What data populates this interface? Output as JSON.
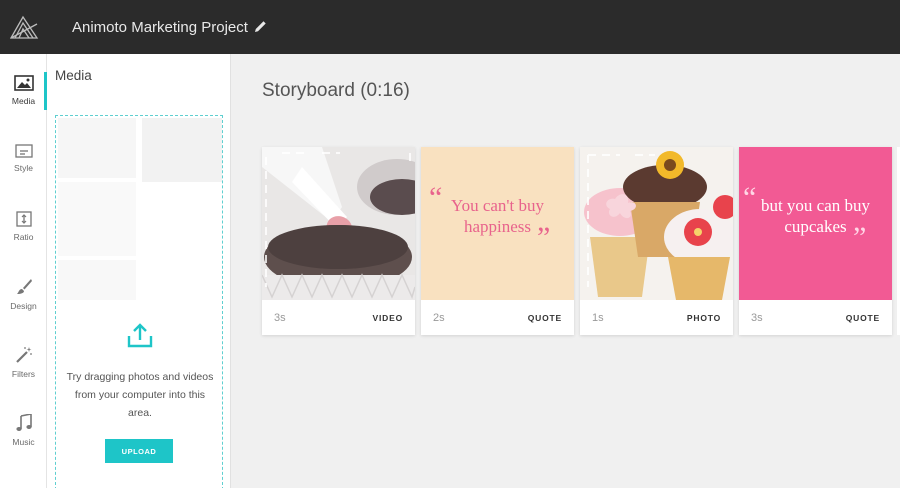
{
  "app": {
    "project_title": "Animoto Marketing Project",
    "accent_color": "#1ec5c8",
    "logo_icon": "animoto-logo-icon"
  },
  "rail": {
    "items": [
      {
        "label": "Media",
        "icon": "image-icon",
        "active": true
      },
      {
        "label": "Style",
        "icon": "style-icon"
      },
      {
        "label": "Ratio",
        "icon": "ratio-icon"
      },
      {
        "label": "Design",
        "icon": "brush-icon"
      },
      {
        "label": "Filters",
        "icon": "magic-wand-icon"
      },
      {
        "label": "Music",
        "icon": "music-note-icon"
      }
    ]
  },
  "media_panel": {
    "title": "Media",
    "drop_text": "Try dragging photos and videos from your computer into this area.",
    "upload_label": "UPLOAD",
    "upload_icon": "upload-icon"
  },
  "storyboard": {
    "title": "Storyboard (0:16)",
    "cards": [
      {
        "duration": "3s",
        "type": "VIDEO",
        "thumb": "cupcake-frosting-video"
      },
      {
        "duration": "2s",
        "type": "QUOTE",
        "quote": "You can't buy happiness",
        "bg": "#f9e1c0",
        "text_color": "#e8638c"
      },
      {
        "duration": "1s",
        "type": "PHOTO",
        "thumb": "cupcakes-photo"
      },
      {
        "duration": "3s",
        "type": "QUOTE",
        "quote": "but you can buy cupcakes",
        "bg": "#f25a94",
        "text_color": "#ffffff"
      }
    ]
  }
}
